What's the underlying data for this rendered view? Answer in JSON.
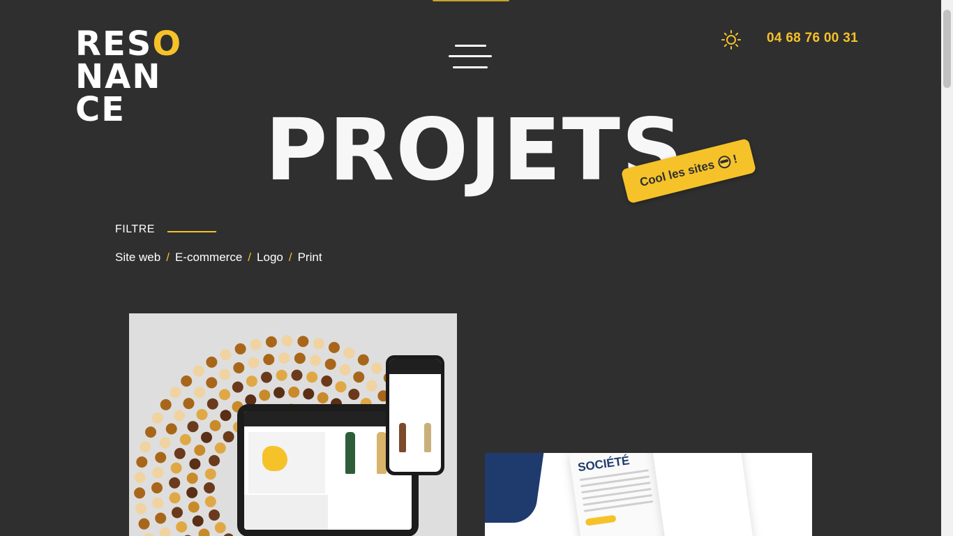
{
  "header": {
    "logo_lines": [
      "RES",
      "NAN",
      "CE"
    ],
    "logo_o": "O",
    "phone": "04 68 76 00 31",
    "menu_icon": "hamburger-icon",
    "theme_icon": "sun-icon"
  },
  "hero": {
    "title": "PROJETS",
    "sticker_text": "Cool les sites",
    "sticker_suffix": "!"
  },
  "filter": {
    "label": "FILTRE",
    "items": [
      "Site web",
      "E-commerce",
      "Logo",
      "Print"
    ],
    "separator": "/"
  },
  "projects": [
    {
      "preview": "Maison des vins de Limoux web mockup"
    },
    {
      "preview": "Société brochure mockup",
      "visible_heading": "SOCIÉTÉ"
    }
  ],
  "colors": {
    "background": "#2f2f2f",
    "accent": "#f5c229",
    "text": "#ffffff",
    "navy": "#1f3b6e"
  }
}
